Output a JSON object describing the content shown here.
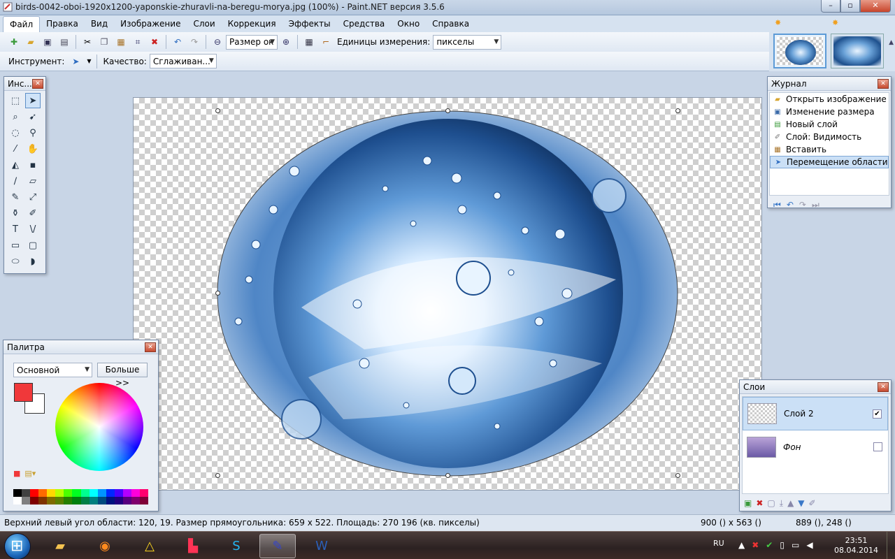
{
  "window": {
    "title": "birds-0042-oboi-1920x1200-yaponskie-zhuravli-na-beregu-morya.jpg (100%) - Paint.NET версия 3.5.6",
    "minimize": "–",
    "maximize": "▫",
    "close": "✕"
  },
  "menu": [
    "Файл",
    "Правка",
    "Вид",
    "Изображение",
    "Слои",
    "Коррекция",
    "Эффекты",
    "Средства",
    "Окно",
    "Справка"
  ],
  "toolbar1": {
    "zoom_value": "Размер ок",
    "units_label": "Единицы измерения:",
    "units_value": "пикселы"
  },
  "toolbar2": {
    "tool_label": "Инструмент:",
    "quality_label": "Качество:",
    "quality_value": "Сглаживан..."
  },
  "tools_window": {
    "title": "Инс..."
  },
  "history_window": {
    "title": "Журнал",
    "items": [
      "Открыть изображение",
      "Изменение размера",
      "Новый слой",
      "Слой: Видимость",
      "Вставить",
      "Перемещение области"
    ]
  },
  "palette_window": {
    "title": "Палитра",
    "mode": "Основной",
    "more_button": "Больше >>",
    "primary_color": "#f0383a",
    "secondary_color": "#ffffff"
  },
  "layers_window": {
    "title": "Слои",
    "layers": [
      {
        "name": "Слой 2",
        "visible": true,
        "selected": true
      },
      {
        "name": "Фон",
        "visible": false,
        "selected": false
      }
    ]
  },
  "status": {
    "selection_info": "Верхний левый угол области: 120, 19. Размер прямоугольника: 659 x 522. Площадь: 270 196 (кв. пикселы)",
    "image_size": "900 () x 563 ()",
    "cursor_pos": "889 (), 248 ()"
  },
  "taskbar": {
    "language": "RU",
    "time": "23:51",
    "date": "08.04.2014"
  }
}
